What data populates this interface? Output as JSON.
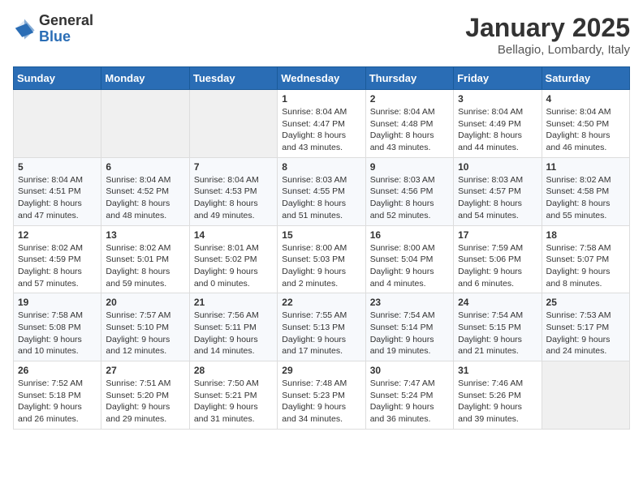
{
  "header": {
    "logo_general": "General",
    "logo_blue": "Blue",
    "month_title": "January 2025",
    "location": "Bellagio, Lombardy, Italy"
  },
  "weekdays": [
    "Sunday",
    "Monday",
    "Tuesday",
    "Wednesday",
    "Thursday",
    "Friday",
    "Saturday"
  ],
  "weeks": [
    [
      {
        "day": "",
        "info": ""
      },
      {
        "day": "",
        "info": ""
      },
      {
        "day": "",
        "info": ""
      },
      {
        "day": "1",
        "info": "Sunrise: 8:04 AM\nSunset: 4:47 PM\nDaylight: 8 hours\nand 43 minutes."
      },
      {
        "day": "2",
        "info": "Sunrise: 8:04 AM\nSunset: 4:48 PM\nDaylight: 8 hours\nand 43 minutes."
      },
      {
        "day": "3",
        "info": "Sunrise: 8:04 AM\nSunset: 4:49 PM\nDaylight: 8 hours\nand 44 minutes."
      },
      {
        "day": "4",
        "info": "Sunrise: 8:04 AM\nSunset: 4:50 PM\nDaylight: 8 hours\nand 46 minutes."
      }
    ],
    [
      {
        "day": "5",
        "info": "Sunrise: 8:04 AM\nSunset: 4:51 PM\nDaylight: 8 hours\nand 47 minutes."
      },
      {
        "day": "6",
        "info": "Sunrise: 8:04 AM\nSunset: 4:52 PM\nDaylight: 8 hours\nand 48 minutes."
      },
      {
        "day": "7",
        "info": "Sunrise: 8:04 AM\nSunset: 4:53 PM\nDaylight: 8 hours\nand 49 minutes."
      },
      {
        "day": "8",
        "info": "Sunrise: 8:03 AM\nSunset: 4:55 PM\nDaylight: 8 hours\nand 51 minutes."
      },
      {
        "day": "9",
        "info": "Sunrise: 8:03 AM\nSunset: 4:56 PM\nDaylight: 8 hours\nand 52 minutes."
      },
      {
        "day": "10",
        "info": "Sunrise: 8:03 AM\nSunset: 4:57 PM\nDaylight: 8 hours\nand 54 minutes."
      },
      {
        "day": "11",
        "info": "Sunrise: 8:02 AM\nSunset: 4:58 PM\nDaylight: 8 hours\nand 55 minutes."
      }
    ],
    [
      {
        "day": "12",
        "info": "Sunrise: 8:02 AM\nSunset: 4:59 PM\nDaylight: 8 hours\nand 57 minutes."
      },
      {
        "day": "13",
        "info": "Sunrise: 8:02 AM\nSunset: 5:01 PM\nDaylight: 8 hours\nand 59 minutes."
      },
      {
        "day": "14",
        "info": "Sunrise: 8:01 AM\nSunset: 5:02 PM\nDaylight: 9 hours\nand 0 minutes."
      },
      {
        "day": "15",
        "info": "Sunrise: 8:00 AM\nSunset: 5:03 PM\nDaylight: 9 hours\nand 2 minutes."
      },
      {
        "day": "16",
        "info": "Sunrise: 8:00 AM\nSunset: 5:04 PM\nDaylight: 9 hours\nand 4 minutes."
      },
      {
        "day": "17",
        "info": "Sunrise: 7:59 AM\nSunset: 5:06 PM\nDaylight: 9 hours\nand 6 minutes."
      },
      {
        "day": "18",
        "info": "Sunrise: 7:58 AM\nSunset: 5:07 PM\nDaylight: 9 hours\nand 8 minutes."
      }
    ],
    [
      {
        "day": "19",
        "info": "Sunrise: 7:58 AM\nSunset: 5:08 PM\nDaylight: 9 hours\nand 10 minutes."
      },
      {
        "day": "20",
        "info": "Sunrise: 7:57 AM\nSunset: 5:10 PM\nDaylight: 9 hours\nand 12 minutes."
      },
      {
        "day": "21",
        "info": "Sunrise: 7:56 AM\nSunset: 5:11 PM\nDaylight: 9 hours\nand 14 minutes."
      },
      {
        "day": "22",
        "info": "Sunrise: 7:55 AM\nSunset: 5:13 PM\nDaylight: 9 hours\nand 17 minutes."
      },
      {
        "day": "23",
        "info": "Sunrise: 7:54 AM\nSunset: 5:14 PM\nDaylight: 9 hours\nand 19 minutes."
      },
      {
        "day": "24",
        "info": "Sunrise: 7:54 AM\nSunset: 5:15 PM\nDaylight: 9 hours\nand 21 minutes."
      },
      {
        "day": "25",
        "info": "Sunrise: 7:53 AM\nSunset: 5:17 PM\nDaylight: 9 hours\nand 24 minutes."
      }
    ],
    [
      {
        "day": "26",
        "info": "Sunrise: 7:52 AM\nSunset: 5:18 PM\nDaylight: 9 hours\nand 26 minutes."
      },
      {
        "day": "27",
        "info": "Sunrise: 7:51 AM\nSunset: 5:20 PM\nDaylight: 9 hours\nand 29 minutes."
      },
      {
        "day": "28",
        "info": "Sunrise: 7:50 AM\nSunset: 5:21 PM\nDaylight: 9 hours\nand 31 minutes."
      },
      {
        "day": "29",
        "info": "Sunrise: 7:48 AM\nSunset: 5:23 PM\nDaylight: 9 hours\nand 34 minutes."
      },
      {
        "day": "30",
        "info": "Sunrise: 7:47 AM\nSunset: 5:24 PM\nDaylight: 9 hours\nand 36 minutes."
      },
      {
        "day": "31",
        "info": "Sunrise: 7:46 AM\nSunset: 5:26 PM\nDaylight: 9 hours\nand 39 minutes."
      },
      {
        "day": "",
        "info": ""
      }
    ]
  ]
}
